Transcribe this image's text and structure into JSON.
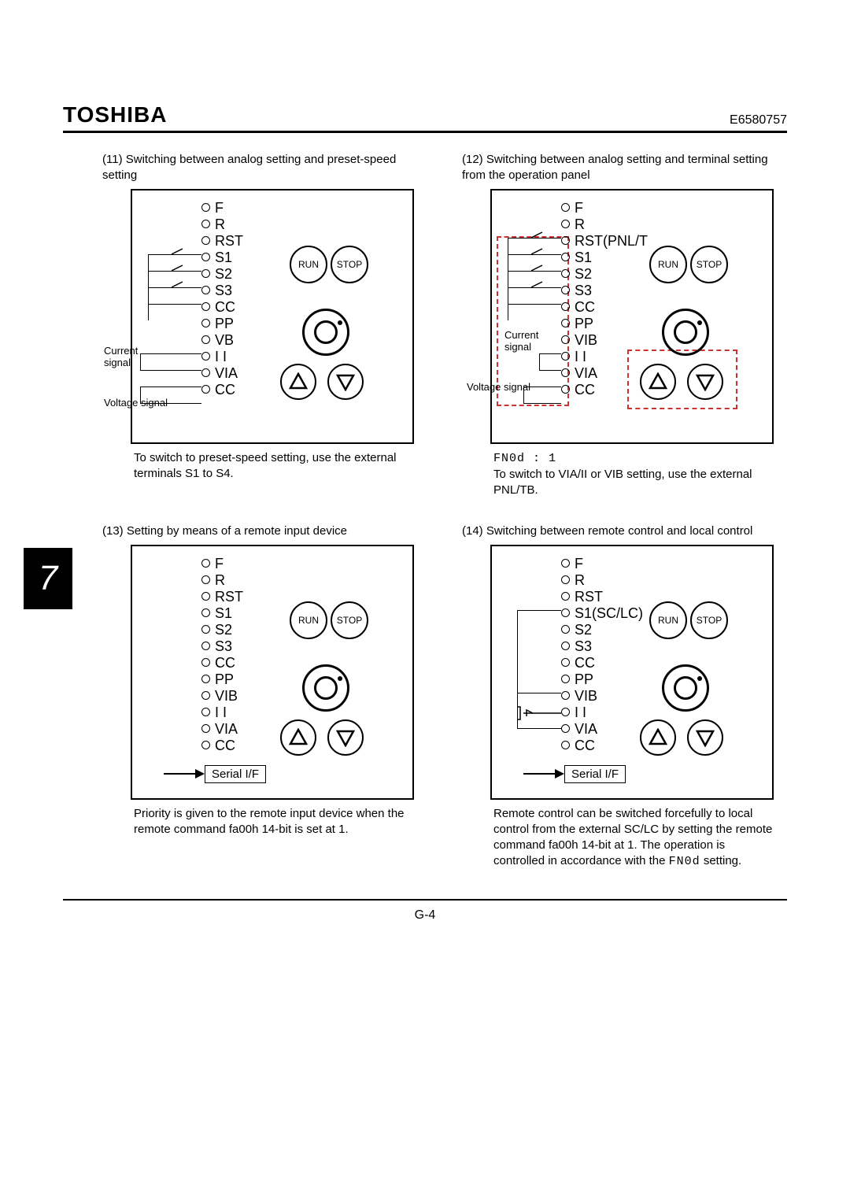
{
  "header": {
    "brand": "TOSHIBA",
    "docid": "E6580757"
  },
  "side_tab": "7",
  "footer": {
    "pageno": "G-4"
  },
  "common": {
    "terminals": [
      "F",
      "R",
      "RST",
      "S1",
      "S2",
      "S3",
      "CC",
      "PP",
      "VIB",
      "I I",
      "VIA",
      "CC"
    ],
    "run": "RUN",
    "stop": "STOP",
    "serial": "Serial I/F",
    "current_signal": "Current",
    "current_signal2": "signal",
    "voltage_signal": "Voltage signal"
  },
  "panes": [
    {
      "caption": "(11) Switching between analog setting and preset-speed setting",
      "rst_label": "RST",
      "s1_label": "S1",
      "vb_label": "VB",
      "note": "To switch to preset-speed setting, use the external terminals S1 to S4.",
      "show_current_voltage": true,
      "show_serial": false,
      "highlight": false
    },
    {
      "caption": "(12) Switching between analog setting and terminal setting from the operation panel",
      "rst_label": "RST(PNL/T",
      "s1_label": "S1",
      "vb_label": "VIB",
      "note_code": "FN0d : 1",
      "note": "To switch to VIA/II or VIB setting, use the external PNL/TB.",
      "show_current_voltage": true,
      "show_serial": false,
      "highlight": true
    },
    {
      "caption": "(13) Setting by means of a remote input device",
      "rst_label": "RST",
      "s1_label": "S1",
      "vb_label": "VIB",
      "note": "Priority is given to the remote input device when the remote command fa00h 14-bit is set at 1.",
      "show_current_voltage": false,
      "show_serial": true,
      "highlight": false
    },
    {
      "caption": "(14) Switching between remote control and local control",
      "rst_label": "RST",
      "s1_label": "S1(SC/LC)",
      "vb_label": "VIB",
      "note": "Remote control can be switched forcefully to local control from the external SC/LC by setting the remote command fa00h 14-bit at 1. The operation is controlled in accordance with the",
      "note_code_inline": "FN0d",
      "note_suffix": " setting.",
      "show_current_voltage": false,
      "show_serial": true,
      "highlight": false
    }
  ]
}
